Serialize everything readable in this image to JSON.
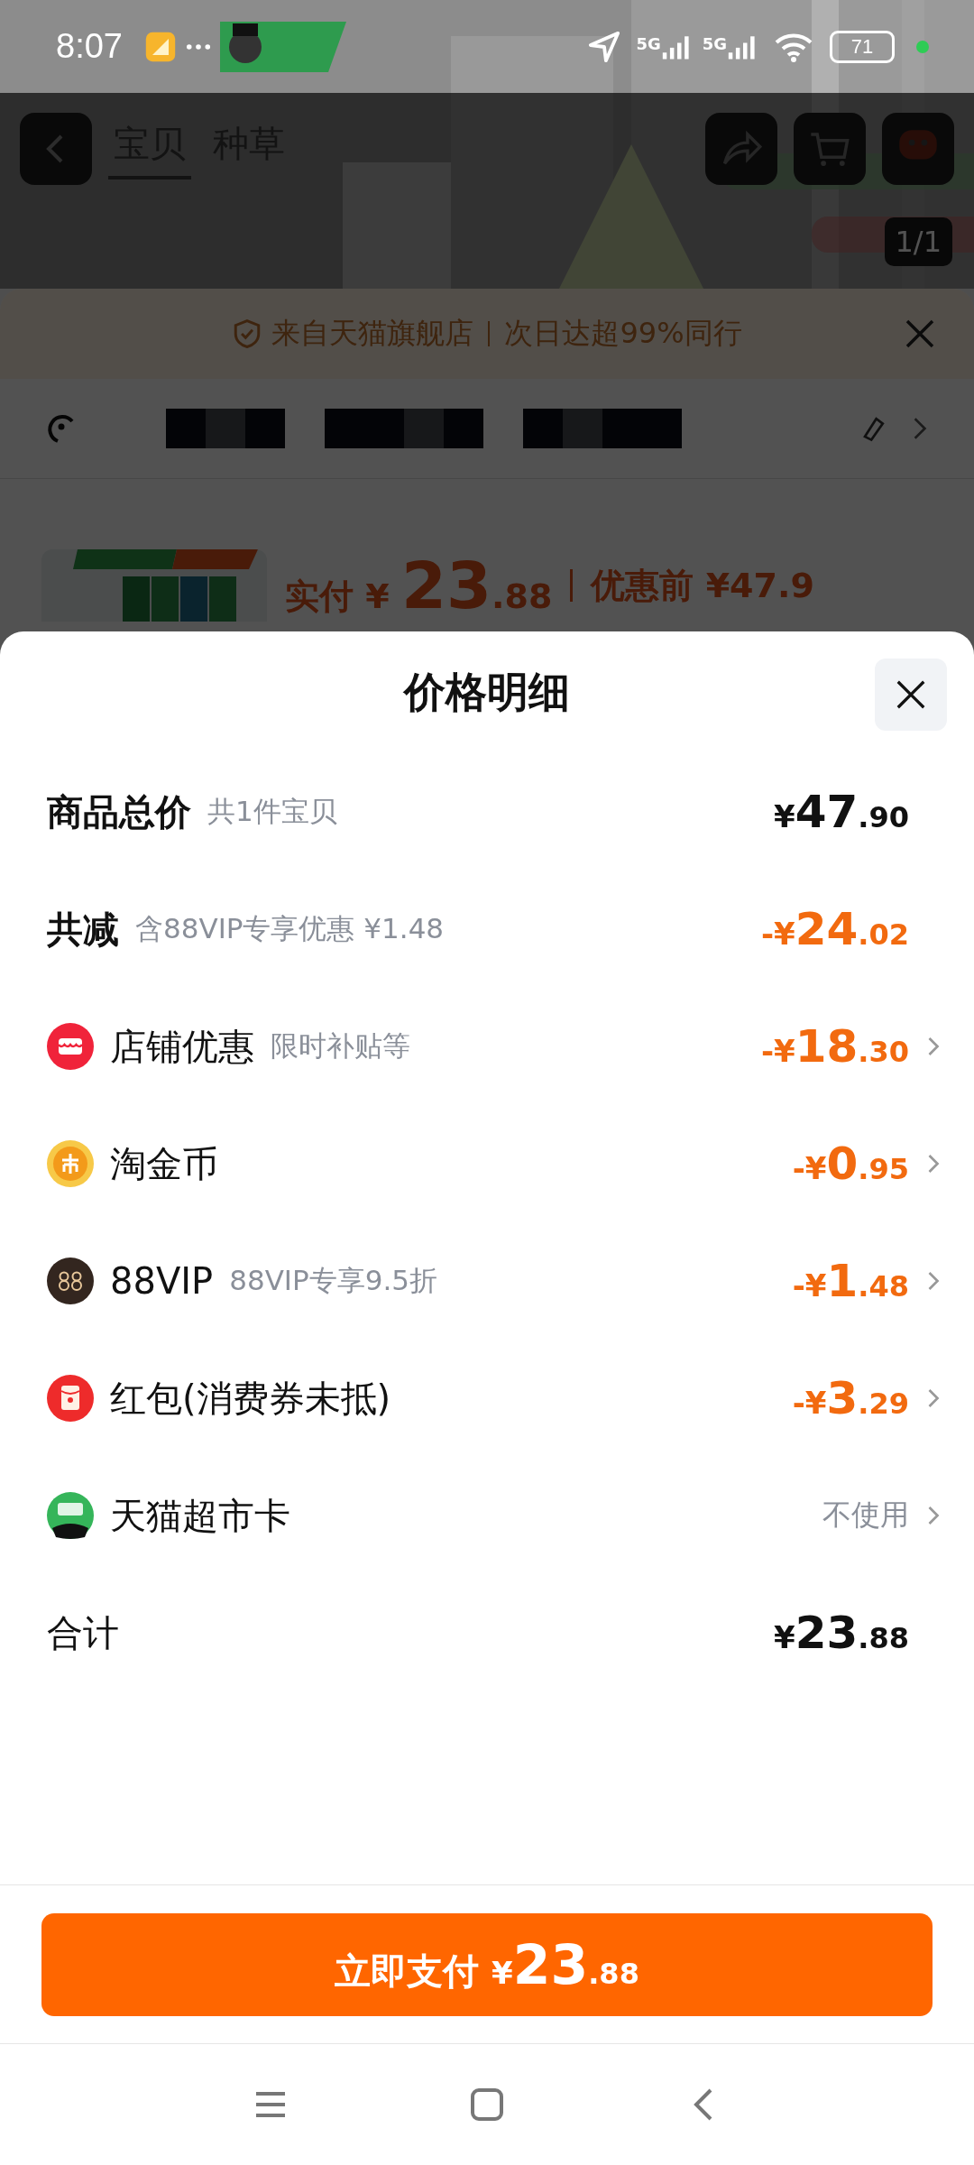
{
  "status_bar": {
    "time": "8:07",
    "network_1": "5G",
    "network_2": "5G",
    "battery": "71"
  },
  "background_page": {
    "tabs": [
      {
        "label": "宝贝",
        "selected": true
      },
      {
        "label": "种草",
        "selected": false
      }
    ],
    "image_counter": "1/1",
    "notice": {
      "store": "来自天猫旗舰店",
      "delivery": "次日达超99%同行"
    },
    "product": {
      "paid_label": "实付",
      "paid_currency": "¥",
      "paid_integer": "23",
      "paid_decimal": ".88",
      "before_label": "优惠前",
      "before_price": "¥47.9"
    }
  },
  "sheet": {
    "title": "价格明细",
    "rows": [
      {
        "kind": "plain",
        "label": "商品总价",
        "note": "共1件宝贝",
        "emphasis": true,
        "deduction": false,
        "has_arrow": false,
        "amount": {
          "prefix": "¥",
          "integer": "47",
          "decimal": ".90"
        }
      },
      {
        "kind": "plain",
        "label": "共减",
        "note": "含88VIP专享优惠 ¥1.48",
        "emphasis": true,
        "deduction": true,
        "has_arrow": false,
        "amount": {
          "prefix": "-¥",
          "integer": "24",
          "decimal": ".02"
        }
      },
      {
        "kind": "shop",
        "label": "店铺优惠",
        "note": "限时补贴等",
        "emphasis": false,
        "deduction": true,
        "has_arrow": true,
        "amount": {
          "prefix": "-¥",
          "integer": "18",
          "decimal": ".30"
        }
      },
      {
        "kind": "coin",
        "label": "淘金币",
        "emphasis": false,
        "deduction": true,
        "has_arrow": true,
        "amount": {
          "prefix": "-¥",
          "integer": "0",
          "decimal": ".95"
        }
      },
      {
        "kind": "vip",
        "label": "88VIP",
        "note": "88VIP专享9.5折",
        "emphasis": false,
        "deduction": true,
        "has_arrow": true,
        "amount": {
          "prefix": "-¥",
          "integer": "1",
          "decimal": ".48"
        }
      },
      {
        "kind": "redpacket",
        "label": "红包(消费券未抵)",
        "emphasis": false,
        "deduction": true,
        "has_arrow": true,
        "amount": {
          "prefix": "-¥",
          "integer": "3",
          "decimal": ".29"
        }
      },
      {
        "kind": "card",
        "label": "天猫超市卡",
        "emphasis": false,
        "has_arrow": true,
        "status": "不使用"
      },
      {
        "kind": "plain",
        "label": "合计",
        "emphasis": false,
        "deduction": false,
        "has_arrow": false,
        "amount": {
          "prefix": "¥",
          "integer": "23",
          "decimal": ".88"
        }
      }
    ],
    "pay_button": {
      "label": "立即支付",
      "prefix": "¥",
      "integer": "23",
      "decimal": ".88"
    }
  }
}
